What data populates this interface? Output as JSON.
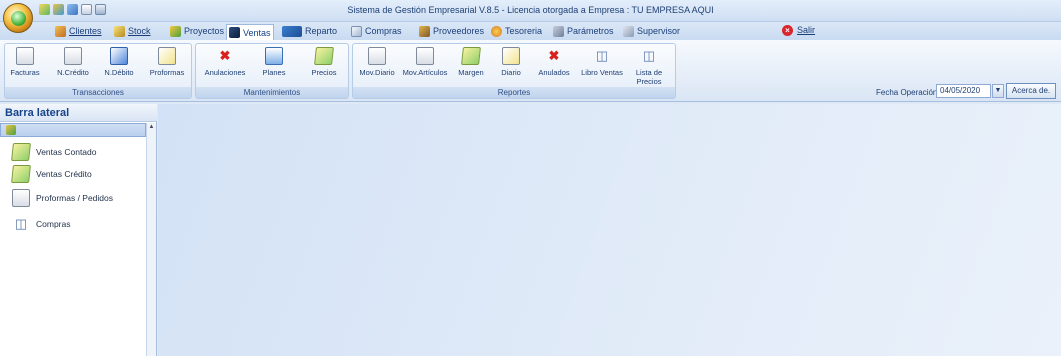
{
  "app": {
    "title": "Sistema de Gestión Empresarial V.8.5 - Licencia otorgada a Empresa : TU EMPRESA AQUI"
  },
  "menu": {
    "items": [
      "Clientes",
      "Stock",
      "Proyectos",
      "Ventas",
      "Reparto",
      "Compras",
      "Proveedores",
      "Tesoreria",
      "Parámetros",
      "Supervisor"
    ],
    "active": "Ventas",
    "exit": "Salir"
  },
  "ribbon": {
    "groups": {
      "transacciones": {
        "label": "Transacciones",
        "buttons": [
          "Facturas",
          "N.Crédito",
          "N.Débito",
          "Proformas"
        ]
      },
      "mantenimientos": {
        "label": "Mantenimientos",
        "buttons": [
          "Anulaciones",
          "Planes",
          "Precios"
        ]
      },
      "reportes": {
        "label": "Reportes",
        "buttons": [
          "Mov.Diario",
          "Mov.Artículos",
          "Margen",
          "Diario",
          "Anulados",
          "Libro Ventas",
          "Lista de Precios"
        ]
      }
    },
    "fecha": {
      "label": "Fecha Operación",
      "value": "04/05/2020"
    },
    "about": "Acerca de."
  },
  "sidebar": {
    "title": "Barra lateral",
    "items": [
      "Ventas Contado",
      "Ventas Crédito",
      "Proformas / Pedidos",
      "Compras"
    ]
  },
  "colors": {
    "accent": "#15428b",
    "ribbon_border": "#a6bfdf",
    "danger": "#d9262c"
  }
}
